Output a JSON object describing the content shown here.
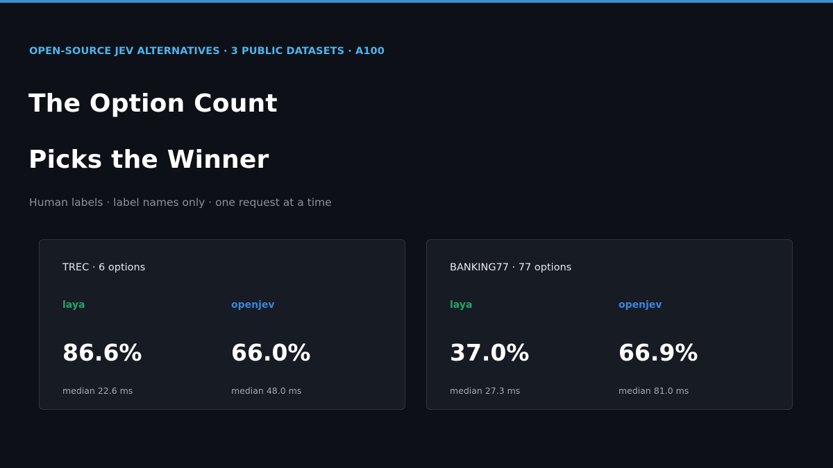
{
  "header": {
    "eyebrow": "OPEN-SOURCE JEV ALTERNATIVES · 3 PUBLIC DATASETS · A100",
    "title_line_1": "The Option Count",
    "title_line_2": "Picks the Winner",
    "subtitle": "Human labels · label names only · one request at a time"
  },
  "cards": [
    {
      "title": "TREC · 6 options",
      "metrics": [
        {
          "name": "laya",
          "value": "86.6%",
          "latency": "median 22.6 ms"
        },
        {
          "name": "openjev",
          "value": "66.0%",
          "latency": "median 48.0 ms"
        }
      ]
    },
    {
      "title": "BANKING77 · 77 options",
      "metrics": [
        {
          "name": "laya",
          "value": "37.0%",
          "latency": "median 27.3 ms"
        },
        {
          "name": "openjev",
          "value": "66.9%",
          "latency": "median 81.0 ms"
        }
      ]
    }
  ],
  "colors": {
    "background": "#0d1017",
    "accent": "#4fb3ec",
    "laya": "#22a56a",
    "openjev": "#3a86dc",
    "card_background": "#171b24"
  }
}
